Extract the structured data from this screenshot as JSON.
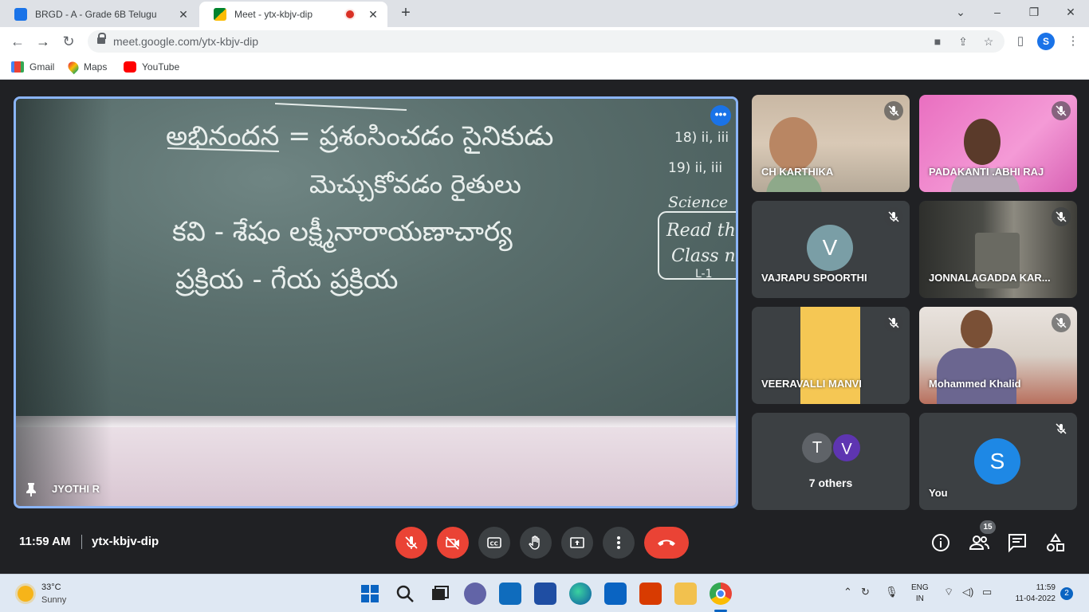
{
  "browser": {
    "tabs": [
      {
        "title": "BRGD - A - Grade 6B Telugu",
        "close": "✕"
      },
      {
        "title": "Meet - ytx-kbjv-dip",
        "close": "✕"
      }
    ],
    "new_tab": "+",
    "window_controls": {
      "minimize": "⌄",
      "restore": "–",
      "maximize": "❐",
      "close": "✕"
    },
    "url": "meet.google.com/ytx-kbjv-dip",
    "profile_initial": "S",
    "bookmarks": [
      "Gmail",
      "Maps",
      "YouTube"
    ]
  },
  "meet": {
    "presenter": {
      "name": "JYOTHI R",
      "more": "•••",
      "board_text": {
        "line1": "అభినందన = ప్రశంసించడం  సైనికుడు",
        "line2": "మెచ్చుకోవడం  రైతులు",
        "line3": "కవి - శేషం లక్ష్మీనారాయణాచార్య",
        "line4": "ప్రక్రియ - గేయ ప్రక్రియ",
        "right1": "18) ii, iii",
        "right2": "19) ii, iii",
        "right3": "Science",
        "right4": "Read th",
        "right5": "Class n",
        "right6": "L-1"
      }
    },
    "participants": [
      {
        "name": "CH KARTHIKA"
      },
      {
        "name": "PADAKANTI .ABHI RAJ"
      },
      {
        "name": "VAJRAPU SPOORTHI",
        "initial": "V"
      },
      {
        "name": "JONNALAGADDA KAR..."
      },
      {
        "name": "VEERAVALLI MANVI"
      },
      {
        "name": "Mohammed Khalid"
      },
      {
        "others_label": "7 others",
        "initials": [
          "T",
          "V"
        ]
      },
      {
        "name": "You",
        "initial": "S"
      }
    ],
    "bottom": {
      "time": "11:59 AM",
      "separator": "|",
      "meeting_code": "ytx-kbjv-dip",
      "people_count": "15"
    }
  },
  "taskbar": {
    "weather_temp": "33°C",
    "weather_desc": "Sunny",
    "lang_top": "ENG",
    "lang_bottom": "IN",
    "time": "11:59",
    "date": "11-04-2022",
    "notifications": "2"
  },
  "colors": {
    "meet_bg": "#202124",
    "tile_bg": "#3c4043",
    "red": "#ea4335",
    "accent": "#1a73e8",
    "active_border": "#8ab4f8"
  }
}
